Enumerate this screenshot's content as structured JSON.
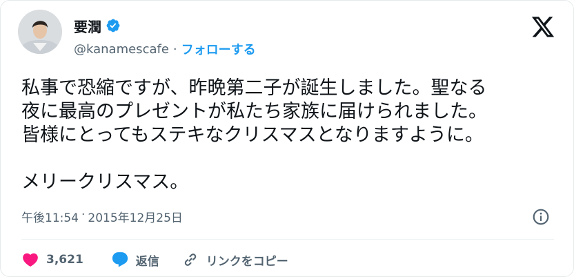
{
  "author": {
    "name": "要潤",
    "handle": "@kanamescafe",
    "separator": "·",
    "follow_label": "フォローする"
  },
  "tweet": {
    "text": "私事で恐縮ですが、昨晩第二子が誕生しました。聖なる\n夜に最高のプレゼントが私たち家族に届けられました。\n皆様にとってもステキなクリスマスとなりますように。\n\nメリークリスマス。",
    "time": "午後11:54",
    "separator": "·",
    "date": "2015年12月25日"
  },
  "actions": {
    "like_count": "3,621",
    "reply_label": "返信",
    "copy_link_label": "リンクをコピー"
  },
  "icons": {
    "logo": "x-logo-icon",
    "verified": "verified-badge-icon",
    "info": "info-icon",
    "like": "heart-icon",
    "reply": "speech-bubble-icon",
    "link": "link-icon"
  },
  "colors": {
    "accent": "#1d9bf0",
    "like": "#f91880",
    "text": "#0f1419",
    "muted": "#536471"
  }
}
